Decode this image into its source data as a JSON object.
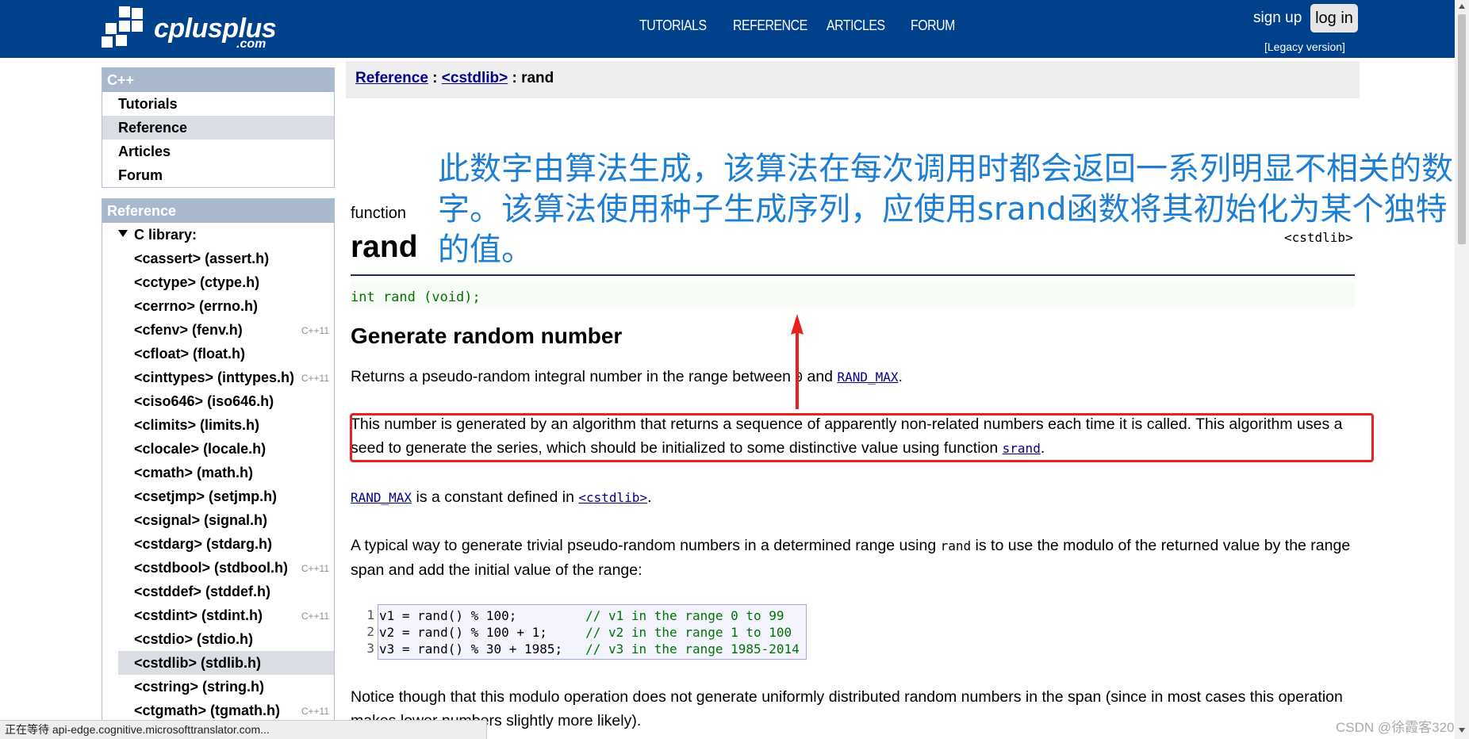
{
  "header": {
    "logo_text": "cplusplus",
    "logo_sub": ".com",
    "nav": [
      "TUTORIALS",
      "REFERENCE",
      "ARTICLES",
      "FORUM"
    ],
    "signup": "sign up",
    "login": "log in",
    "legacy": "[Legacy version]",
    "brand_color": "#00418c"
  },
  "sidebar": {
    "cpp": {
      "title": "C++",
      "items": [
        "Tutorials",
        "Reference",
        "Articles",
        "Forum"
      ],
      "active": "Reference"
    },
    "reference": {
      "title": "Reference",
      "group": "C library:",
      "items": [
        {
          "label": "<cassert> (assert.h)",
          "badge": ""
        },
        {
          "label": "<cctype> (ctype.h)",
          "badge": ""
        },
        {
          "label": "<cerrno> (errno.h)",
          "badge": ""
        },
        {
          "label": "<cfenv> (fenv.h)",
          "badge": "C++11"
        },
        {
          "label": "<cfloat> (float.h)",
          "badge": ""
        },
        {
          "label": "<cinttypes> (inttypes.h)",
          "badge": "C++11"
        },
        {
          "label": "<ciso646> (iso646.h)",
          "badge": ""
        },
        {
          "label": "<climits> (limits.h)",
          "badge": ""
        },
        {
          "label": "<clocale> (locale.h)",
          "badge": ""
        },
        {
          "label": "<cmath> (math.h)",
          "badge": ""
        },
        {
          "label": "<csetjmp> (setjmp.h)",
          "badge": ""
        },
        {
          "label": "<csignal> (signal.h)",
          "badge": ""
        },
        {
          "label": "<cstdarg> (stdarg.h)",
          "badge": ""
        },
        {
          "label": "<cstdbool> (stdbool.h)",
          "badge": "C++11"
        },
        {
          "label": "<cstddef> (stddef.h)",
          "badge": ""
        },
        {
          "label": "<cstdint> (stdint.h)",
          "badge": "C++11"
        },
        {
          "label": "<cstdio> (stdio.h)",
          "badge": ""
        },
        {
          "label": "<cstdlib> (stdlib.h)",
          "badge": ""
        },
        {
          "label": "<cstring> (string.h)",
          "badge": ""
        },
        {
          "label": "<ctgmath> (tgmath.h)",
          "badge": "C++11"
        }
      ],
      "active": "<cstdlib> (stdlib.h)"
    }
  },
  "breadcrumb": {
    "reference": "Reference",
    "sep1": " : ",
    "cstdlib": "<cstdlib>",
    "sep2": " : ",
    "current": "rand"
  },
  "page": {
    "kind": "function",
    "title": "rand",
    "header": "<cstdlib>",
    "prototype": "int rand (void);",
    "heading": "Generate random number",
    "p1": {
      "a": "Returns a pseudo-random integral number in the range between ",
      "zero": "0",
      "b": " and ",
      "link": "RAND_MAX",
      "c": "."
    },
    "p2": {
      "a": "This number is generated by an algorithm that returns a sequence of apparently non-related numbers each time it is called. This algorithm uses a seed to generate the series, which should be initialized to some distinctive value using function ",
      "link": "srand",
      "b": "."
    },
    "p3": {
      "link1": "RAND_MAX",
      "a": " is a constant defined in ",
      "link2": "<cstdlib>",
      "b": "."
    },
    "p4": {
      "a": "A typical way to generate trivial pseudo-random numbers in a determined range using ",
      "code": "rand",
      "b": " is to use the modulo of the returned value by the range span and add the initial value of the range:"
    },
    "example": [
      {
        "n": "1",
        "code": "v1 = rand() % 100;         ",
        "comment": "// v1 in the range 0 to 99"
      },
      {
        "n": "2",
        "code": "v2 = rand() % 100 + 1;     ",
        "comment": "// v2 in the range 1 to 100"
      },
      {
        "n": "3",
        "code": "v3 = rand() % 30 + 1985;   ",
        "comment": "// v3 in the range 1985-2014"
      }
    ],
    "p5": "Notice though that this modulo operation does not generate uniformly distributed random numbers in the span (since in most cases this operation makes lower numbers slightly more likely)."
  },
  "annotation": {
    "note": "此数字由算法生成，该算法在每次调用时都会返回一系列明显不相关的数字。该算法使用种子生成序列，应使用srand函数将其初始化为某个独特的值。",
    "note_color": "#1e7fd2",
    "box_color": "#e8211d"
  },
  "status_bar": "正在等待 api-edge.cognitive.microsofttranslator.com...",
  "watermark": "CSDN @徐霞客320"
}
